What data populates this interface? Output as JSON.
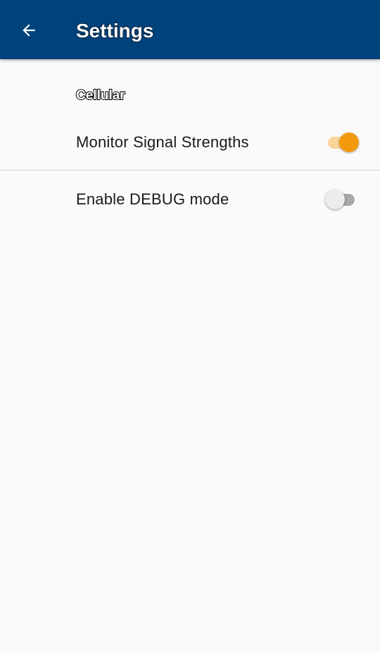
{
  "app_bar": {
    "title": "Settings",
    "back_icon": "arrow-back-icon",
    "background_color": "#00437c"
  },
  "settings": {
    "category_label": "Cellular",
    "items": [
      {
        "label": "Monitor Signal Strengths",
        "enabled": true
      },
      {
        "label": "Enable DEBUG mode",
        "enabled": false
      }
    ]
  },
  "colors": {
    "accent": "#f29a0c",
    "accent_track": "#f9d597",
    "off_thumb": "#ececec",
    "off_track": "#a8a8a8",
    "background": "#fafafa"
  }
}
